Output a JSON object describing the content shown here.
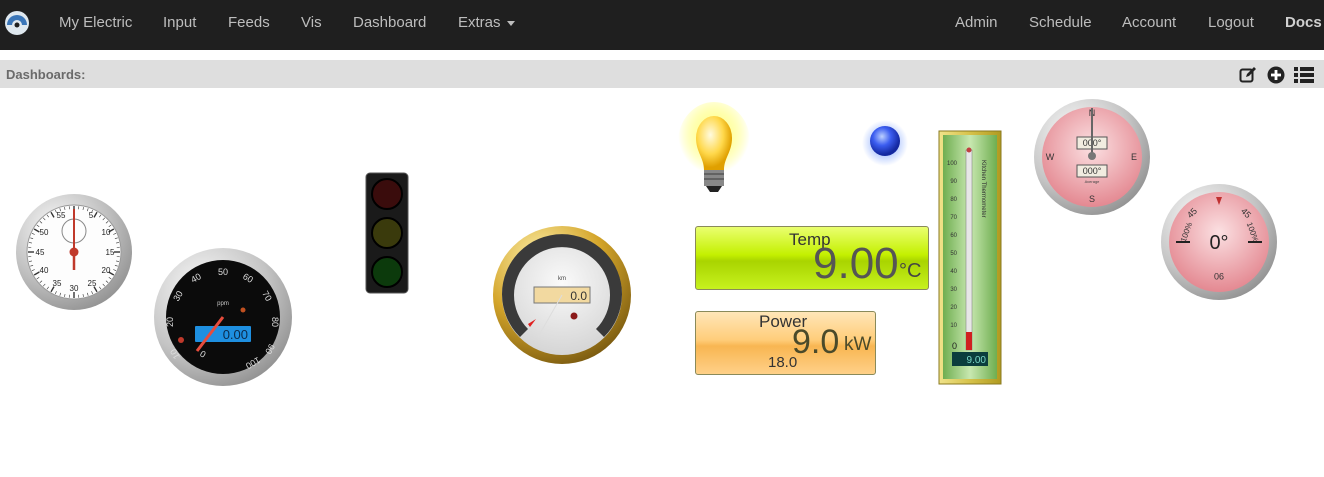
{
  "nav": {
    "left": [
      "My Electric",
      "Input",
      "Feeds",
      "Vis",
      "Dashboard",
      "Extras"
    ],
    "right": [
      "Admin",
      "Schedule",
      "Account",
      "Logout",
      "Docs"
    ]
  },
  "dashbar": {
    "label": "Dashboards:"
  },
  "widgets": {
    "stopwatch": {
      "ticks": [
        "55",
        "5",
        "50",
        "10",
        "45",
        "15",
        "40",
        "20",
        "35",
        "25",
        "30"
      ]
    },
    "speedo": {
      "ticks": [
        "10",
        "20",
        "30",
        "40",
        "50",
        "60",
        "70",
        "80",
        "90",
        "100",
        "0"
      ],
      "unit": "ppm",
      "display": "0.00"
    },
    "traffic_light": {
      "state": "off"
    },
    "dial": {
      "display": "0.0",
      "unit": "km"
    },
    "bulb": {
      "state": "on"
    },
    "led": {
      "color": "#3355ee"
    },
    "temp_box": {
      "title": "Temp",
      "value": "9.00",
      "unit": "°C"
    },
    "power_box": {
      "title": "Power",
      "value": "9.0",
      "unit": "kW",
      "sub": "18.0"
    },
    "thermometer": {
      "label": "Kitchen Thermometer",
      "display": "9.00",
      "ticks": [
        "100",
        "90",
        "80",
        "70",
        "60",
        "50",
        "40",
        "30",
        "20",
        "10",
        "0"
      ],
      "level": 0.09
    },
    "compass": {
      "top": "000°",
      "bottom": "000°",
      "sub": "Average",
      "dirs": [
        "N",
        "E",
        "S",
        "W"
      ]
    },
    "inclinometer": {
      "value": "0°",
      "marks": [
        "45",
        "100%",
        "90"
      ]
    }
  }
}
